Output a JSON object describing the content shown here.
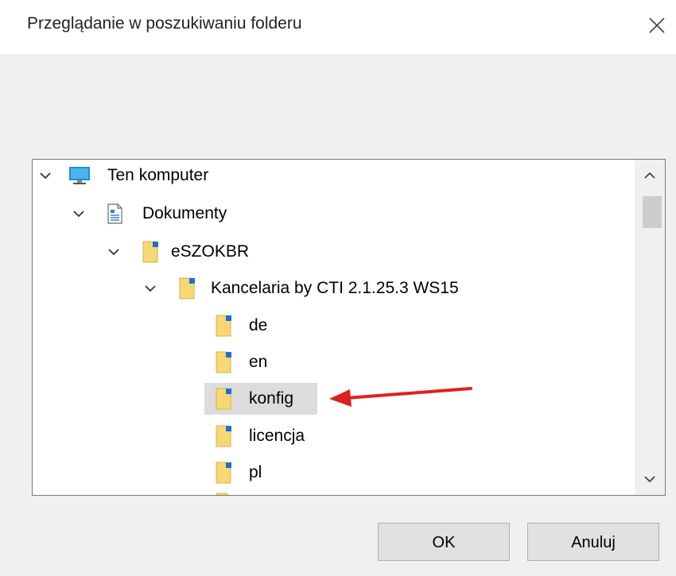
{
  "dialog": {
    "title": "Przeglądanie w poszukiwaniu folderu"
  },
  "tree": [
    {
      "label": "Ten komputer",
      "icon": "computer-icon",
      "expanded": true,
      "level": 0
    },
    {
      "label": "Dokumenty",
      "icon": "documents-icon",
      "expanded": true,
      "level": 1
    },
    {
      "label": "eSZOKBR",
      "icon": "folder-icon",
      "expanded": true,
      "level": 2
    },
    {
      "label": "Kancelaria by CTI 2.1.25.3 WS15",
      "icon": "folder-icon",
      "expanded": true,
      "level": 3
    },
    {
      "label": "de",
      "icon": "folder-icon",
      "level": 4
    },
    {
      "label": "en",
      "icon": "folder-icon",
      "level": 4
    },
    {
      "label": "konfig",
      "icon": "folder-icon",
      "level": 4,
      "selected": true
    },
    {
      "label": "licencja",
      "icon": "folder-icon",
      "level": 4
    },
    {
      "label": "pl",
      "icon": "folder-icon",
      "level": 4
    }
  ],
  "buttons": {
    "ok_label": "OK",
    "cancel_label": "Anuluj"
  },
  "colors": {
    "selection": "#dcdcdc",
    "annotation_arrow": "#e02020",
    "folder": "#f8d775"
  }
}
